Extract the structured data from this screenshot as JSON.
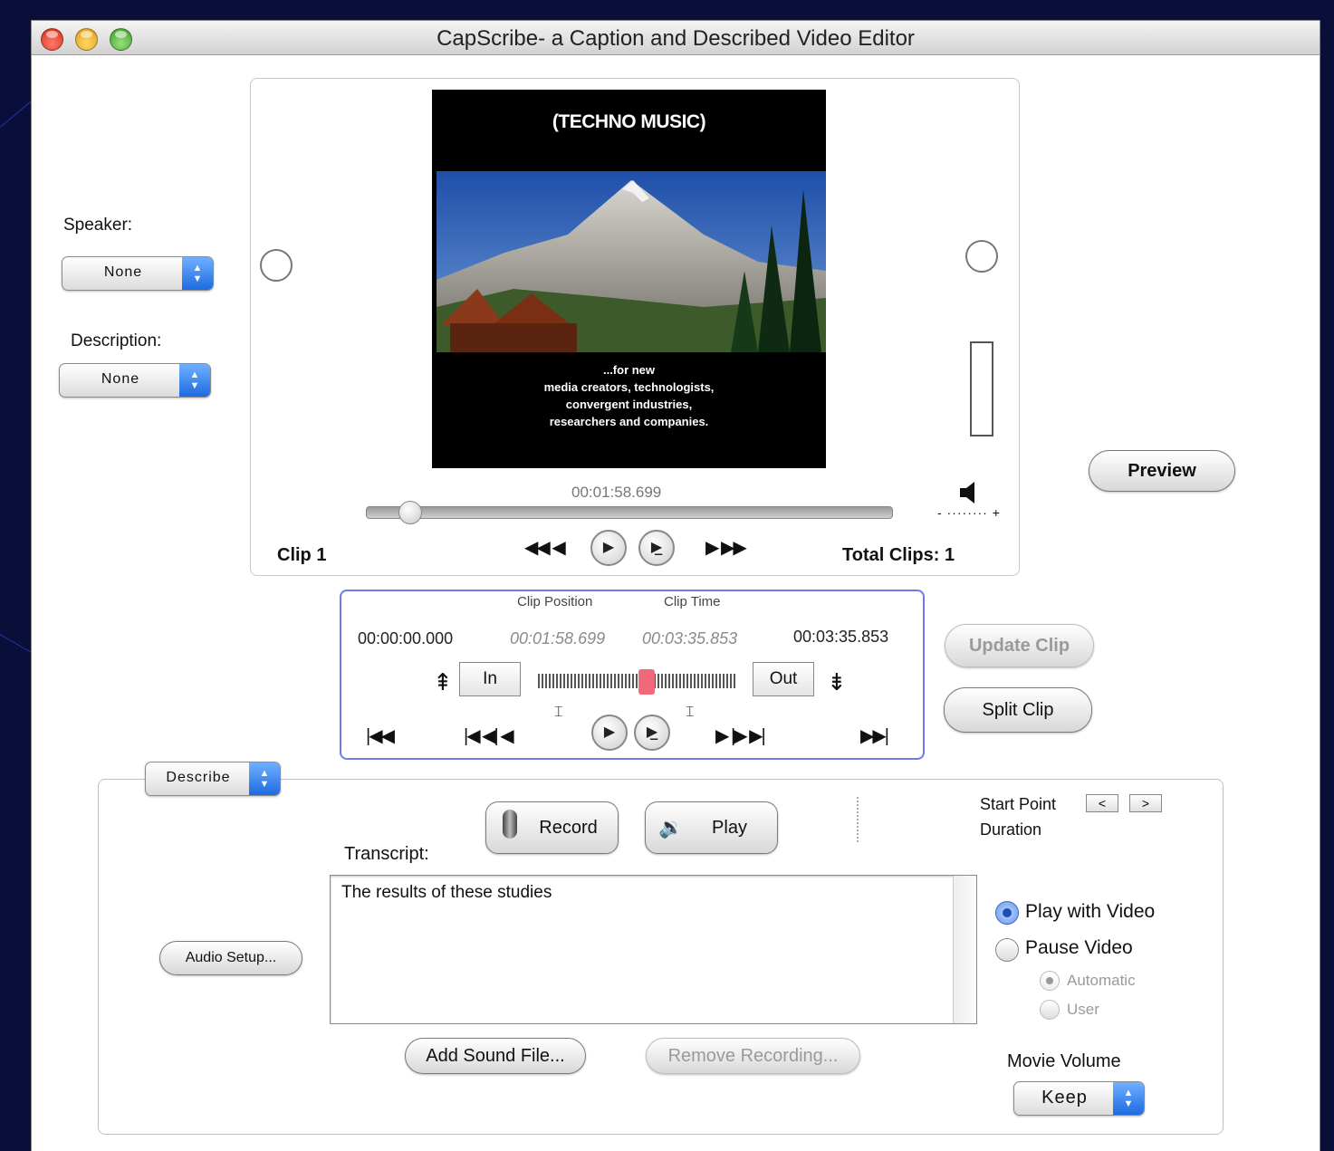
{
  "window": {
    "title": "CapScribe- a Caption and Described Video Editor"
  },
  "left_panel": {
    "speaker_label": "Speaker:",
    "speaker_value": "None",
    "description_label": "Description:",
    "description_value": "None"
  },
  "video": {
    "caption_top": "(TECHNO MUSIC)",
    "caption_bottom": [
      "...for new",
      "media creators, technologists,",
      "convergent industries,",
      "researchers and companies."
    ],
    "timecode": "00:01:58.699",
    "clip_label": "Clip 1",
    "total_clips": "Total Clips: 1",
    "playhead_progress": 0.06
  },
  "right_buttons": {
    "preview": "Preview",
    "update_clip": "Update Clip",
    "split_clip": "Split Clip"
  },
  "clip_editor": {
    "clip_position_label": "Clip Position",
    "clip_time_label": "Clip Time",
    "start_time": "00:00:00.000",
    "clip_position": "00:01:58.699",
    "clip_time": "00:03:35.853",
    "end_time": "00:03:35.853",
    "in_label": "In",
    "out_label": "Out",
    "scrubber_position": 0.55
  },
  "describe": {
    "mode_value": "Describe",
    "record": "Record",
    "play": "Play",
    "transcript_label": "Transcript:",
    "transcript_text": "The results of these studies",
    "start_point_label": "Start Point",
    "duration_label": "Duration",
    "prev_arrow": "<",
    "next_arrow": ">",
    "audio_setup": "Audio Setup...",
    "add_sound_file": "Add Sound File...",
    "remove_recording": "Remove Recording...",
    "play_with_video": "Play with Video",
    "pause_video": "Pause Video",
    "automatic": "Automatic",
    "user": "User",
    "movie_volume_label": "Movie Volume",
    "movie_volume_value": "Keep",
    "selected_mode": "Play with Video"
  },
  "icons": [
    "close-icon",
    "minimize-icon",
    "zoom-icon",
    "popup-arrows-icon",
    "volume-icon",
    "rewind-icon",
    "play-icon",
    "play-selection-icon",
    "fast-forward-icon",
    "go-to-start-icon",
    "step-back-icon",
    "step-forward-icon",
    "go-to-end-icon",
    "microphone-icon",
    "speaker-icon"
  ]
}
